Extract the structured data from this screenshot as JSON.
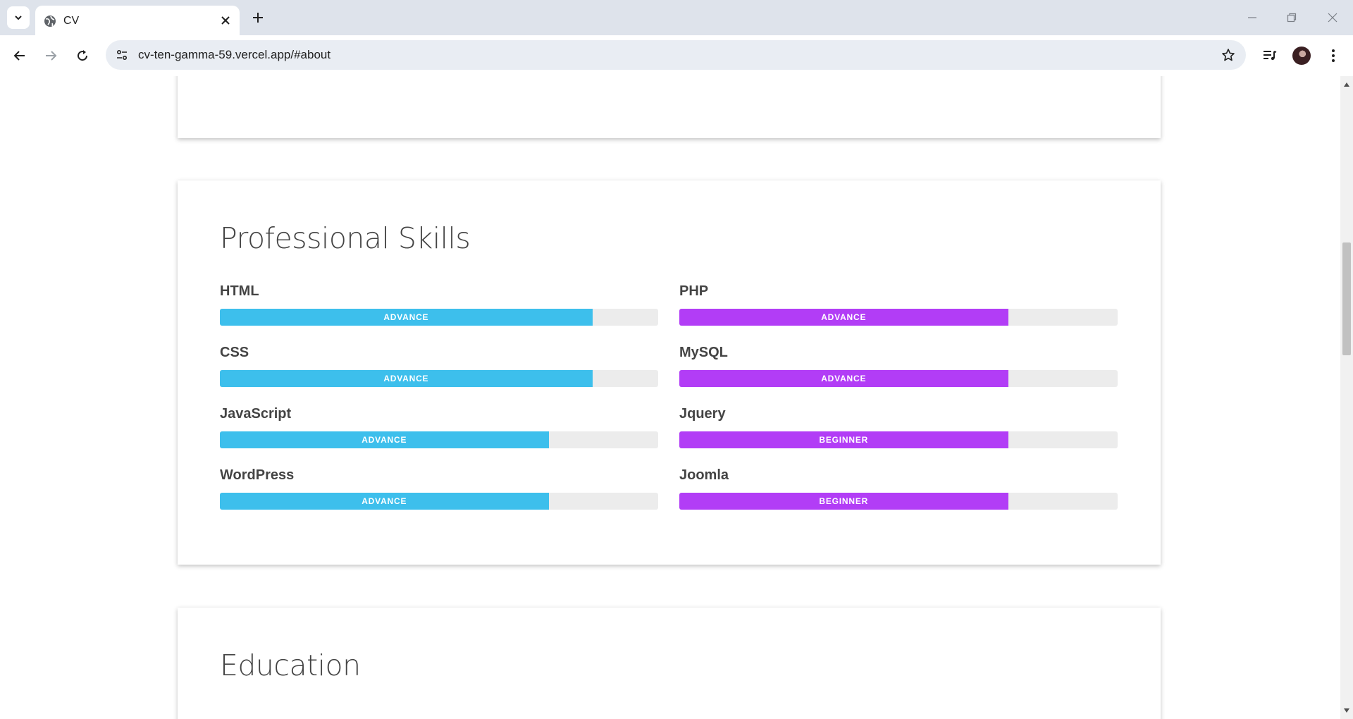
{
  "browser": {
    "tab_title": "CV",
    "url": "cv-ten-gamma-59.vercel.app/#about",
    "icons": [
      "tab-search-icon",
      "globe-icon",
      "close-icon",
      "plus-icon",
      "minimize-icon",
      "restore-icon",
      "window-close-icon",
      "back-icon",
      "forward-icon",
      "reload-icon",
      "site-settings-icon",
      "bookmark-star-icon",
      "media-controls-icon",
      "profile-avatar",
      "menu-kebab-icon"
    ]
  },
  "page": {
    "about_cut_text": "",
    "skills_section": {
      "title": "Professional Skills",
      "left_color": "#3dbfec",
      "right_color": "#b23df6",
      "skills": [
        {
          "name": "HTML",
          "level": "ADVANCE",
          "percent": 85,
          "color": "#3dbfec"
        },
        {
          "name": "CSS",
          "level": "ADVANCE",
          "percent": 85,
          "color": "#3dbfec"
        },
        {
          "name": "JavaScript",
          "level": "ADVANCE",
          "percent": 75,
          "color": "#3dbfec"
        },
        {
          "name": "WordPress",
          "level": "ADVANCE",
          "percent": 75,
          "color": "#3dbfec"
        },
        {
          "name": "PHP",
          "level": "ADVANCE",
          "percent": 75,
          "color": "#b23df6"
        },
        {
          "name": "MySQL",
          "level": "ADVANCE",
          "percent": 75,
          "color": "#b23df6"
        },
        {
          "name": "Jquery",
          "level": "BEGINNER",
          "percent": 75,
          "color": "#b23df6"
        },
        {
          "name": "Joomla",
          "level": "BEGINNER",
          "percent": 75,
          "color": "#b23df6"
        }
      ]
    },
    "education_section": {
      "title": "Education"
    }
  }
}
